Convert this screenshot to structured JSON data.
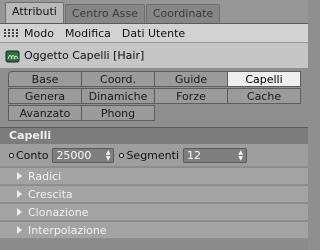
{
  "window_tabs": [
    "Attributi",
    "Centro Asse",
    "Coordinate"
  ],
  "menu": [
    "Modo",
    "Modifica",
    "Dati Utente"
  ],
  "object_title": "Oggetto Capelli [Hair]",
  "property_tabs": [
    [
      "Base",
      "Coord.",
      "Guide",
      "Capelli"
    ],
    [
      "Genera",
      "Dinamiche",
      "Forze",
      "Cache"
    ],
    [
      "Avanzato",
      "Phong"
    ]
  ],
  "active_tab": "Capelli",
  "section_title": "Capelli",
  "params": {
    "conto_label": "Conto",
    "conto_value": "25000",
    "segmenti_label": "Segmenti",
    "segmenti_value": "12"
  },
  "groups": [
    "Radici",
    "Crescita",
    "Clonazione",
    "Interpolazione"
  ],
  "icons": [
    "grip-icon",
    "hair-object-icon",
    "spinner-arrows-icon",
    "expand-caret-icon"
  ]
}
